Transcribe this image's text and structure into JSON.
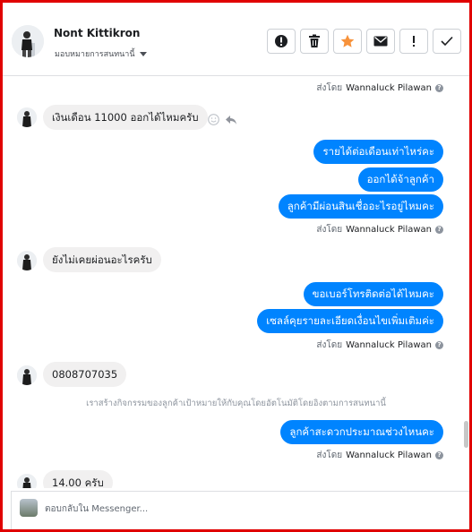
{
  "header": {
    "contact_name": "Nont Kittikron",
    "assign_label": "มอบหมายการสนทนานี้",
    "toolbar": [
      {
        "icon": "alert-circle-icon",
        "name": "mark-spam-button"
      },
      {
        "icon": "trash-icon",
        "name": "delete-button"
      },
      {
        "icon": "star-icon",
        "name": "star-button"
      },
      {
        "icon": "envelope-icon",
        "name": "mark-unread-button"
      },
      {
        "icon": "exclamation-icon",
        "name": "follow-up-button"
      },
      {
        "icon": "check-icon",
        "name": "mark-done-button"
      }
    ]
  },
  "thread": {
    "sent_by_prefix": "ส่งโดย",
    "agent_name": "Wannaluck Pilawan",
    "messages": [
      {
        "dir": "in",
        "text": "เงินเดือน 11000 ออกได้ไหมครับ"
      },
      {
        "dir": "out",
        "text": "รายได้ต่อเดือนเท่าไหร่คะ"
      },
      {
        "dir": "out",
        "text": "ออกได้จ้าลูกค้า"
      },
      {
        "dir": "out",
        "text": "ลูกค้ามีผ่อนสินเชื่ออะไรอยู่ไหมคะ"
      },
      {
        "dir": "in",
        "text": "ยังไม่เคยผ่อนอะไรครับ"
      },
      {
        "dir": "out",
        "text": "ขอเบอร์โทรติดต่อได้ไหมคะ"
      },
      {
        "dir": "out",
        "text": "เซลล์คุยรายละเอียดเงื่อนไขเพิ่มเติมค่ะ"
      },
      {
        "dir": "in",
        "text": "0808707035"
      },
      {
        "dir": "out",
        "text": "ลูกค้าสะดวกประมาณช่วงไหนคะ"
      },
      {
        "dir": "in",
        "text": "14.00 ครับ"
      }
    ],
    "notice": "เราสร้างกิจกรรมของลูกค้าเป้าหมายให้กับคุณโดยอัตโนมัติโดยอิงตามการสนทนานี้"
  },
  "composer": {
    "placeholder": "ตอบกลับใน Messenger..."
  },
  "colors": {
    "accent": "#0084ff",
    "incoming_bubble": "#f1f0f0",
    "star": "#f7923b",
    "frame": "#e00000"
  }
}
